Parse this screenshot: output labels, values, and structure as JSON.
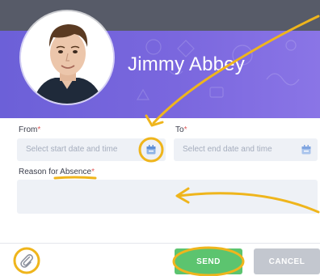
{
  "student": {
    "name": "Jimmy Abbey"
  },
  "form": {
    "from_label": "From",
    "to_label": "To",
    "required_marker": "*",
    "from_placeholder": "Select start date and time",
    "to_placeholder": "Select end date and time",
    "reason_label": "Reason for Absence"
  },
  "actions": {
    "send_label": "SEND",
    "cancel_label": "CANCEL"
  },
  "colors": {
    "header_purple": "#7065dc",
    "top_bar": "#575b68",
    "send_green": "#5cc46f",
    "cancel_gray": "#c3c7cf",
    "annotation_yellow": "#efb51c",
    "field_bg": "#eef1f6"
  },
  "icons": {
    "from_calendar": "calendar-icon",
    "to_calendar": "calendar-icon",
    "attachment": "paperclip-icon"
  }
}
